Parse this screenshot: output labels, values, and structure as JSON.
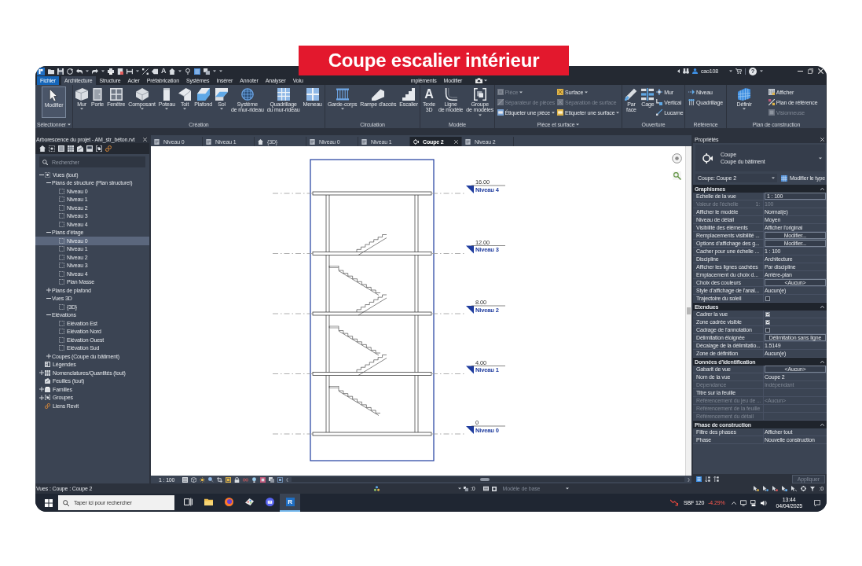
{
  "banner": {
    "text": "Coupe escalier intérieur"
  },
  "title_bar": {
    "glyph": "A",
    "user": "cao108",
    "help": "?"
  },
  "ribbon": {
    "tabs": [
      {
        "label": "Fichier",
        "kind": "file",
        "selected": false
      },
      {
        "label": "Architecture",
        "kind": "tab",
        "selected": true
      },
      {
        "label": "Structure",
        "kind": "tab",
        "selected": false
      },
      {
        "label": "Acier",
        "kind": "tab",
        "selected": false
      },
      {
        "label": "Préfabrication",
        "kind": "tab",
        "selected": false
      },
      {
        "label": "Systèmes",
        "kind": "tab",
        "selected": false
      },
      {
        "label": "Insérer",
        "kind": "tab",
        "selected": false
      },
      {
        "label": "Annoter",
        "kind": "tab",
        "selected": false
      },
      {
        "label": "Analyser",
        "kind": "tab",
        "selected": false
      },
      {
        "label": "Volu",
        "kind": "partial",
        "selected": false
      },
      {
        "label": "mpléments",
        "kind": "partial",
        "selected": false
      },
      {
        "label": "Modifier",
        "kind": "tab",
        "selected": false
      }
    ],
    "panels": [
      {
        "title": "Sélectionner",
        "dropdown": true,
        "tools": [
          {
            "label": "Modifier",
            "kind": "large",
            "selected": true,
            "dropdown": false,
            "disabled": false
          }
        ]
      },
      {
        "title": "Création",
        "dropdown": false,
        "tools": [
          {
            "label": "Mur",
            "kind": "large",
            "selected": false,
            "dropdown": true,
            "disabled": false
          },
          {
            "label": "Porte",
            "kind": "large",
            "selected": false,
            "dropdown": false,
            "disabled": false
          },
          {
            "label": "Fenêtre",
            "kind": "large",
            "selected": false,
            "dropdown": false,
            "disabled": false
          },
          {
            "label": "Composant",
            "kind": "large",
            "selected": false,
            "dropdown": true,
            "disabled": false
          },
          {
            "label": "Poteau",
            "kind": "large",
            "selected": false,
            "dropdown": true,
            "disabled": false
          },
          {
            "label": "Toit",
            "kind": "large",
            "selected": false,
            "dropdown": true,
            "disabled": false
          },
          {
            "label": "Plafond",
            "kind": "large",
            "selected": false,
            "dropdown": false,
            "disabled": false
          },
          {
            "label": "Sol",
            "kind": "large",
            "selected": false,
            "dropdown": true,
            "disabled": false
          },
          {
            "label": "Système\nde mur-rideau",
            "kind": "large",
            "selected": false,
            "dropdown": false,
            "disabled": false
          },
          {
            "label": "Quadrillage\ndu mur-rideau",
            "kind": "large",
            "selected": false,
            "dropdown": false,
            "disabled": false
          },
          {
            "label": "Meneau",
            "kind": "large",
            "selected": false,
            "dropdown": false,
            "disabled": false
          }
        ]
      },
      {
        "title": "Circulation",
        "dropdown": false,
        "tools": [
          {
            "label": "Garde-corps",
            "kind": "large",
            "selected": false,
            "dropdown": true,
            "disabled": false
          },
          {
            "label": "Rampe d'accès",
            "kind": "large",
            "selected": false,
            "dropdown": false,
            "disabled": false
          },
          {
            "label": "Escalier",
            "kind": "large",
            "selected": false,
            "dropdown": false,
            "disabled": false
          }
        ]
      },
      {
        "title": "Modèle",
        "dropdown": false,
        "tools": [
          {
            "label": "Texte\n3D",
            "glyph": "A",
            "kind": "large",
            "selected": false,
            "dropdown": false,
            "disabled": false
          },
          {
            "label": "Ligne\nde modèle",
            "kind": "large",
            "selected": false,
            "dropdown": false,
            "disabled": false
          },
          {
            "label": "Groupe\nde modèles",
            "kind": "large",
            "selected": false,
            "dropdown": true,
            "disabled": false
          }
        ]
      },
      {
        "title": "Pièce et surface",
        "dropdown": true,
        "tools": [
          {
            "label": "Pièce",
            "kind": "small",
            "selected": false,
            "dropdown": true,
            "disabled": true
          },
          {
            "label": "Séparateur de pièces",
            "kind": "small",
            "selected": false,
            "dropdown": false,
            "disabled": true
          },
          {
            "label": "Étiqueter une pièce",
            "kind": "small",
            "selected": false,
            "dropdown": true,
            "disabled": false
          },
          {
            "label": "Surface",
            "kind": "small",
            "selected": false,
            "dropdown": true,
            "disabled": false
          },
          {
            "label": "Séparation de surface",
            "kind": "small",
            "selected": false,
            "dropdown": false,
            "disabled": true
          },
          {
            "label": "Etiqueter une surface",
            "kind": "small",
            "selected": false,
            "dropdown": true,
            "disabled": false
          }
        ]
      },
      {
        "title": "Ouverture",
        "dropdown": false,
        "tools": [
          {
            "label": "Par\nface",
            "kind": "large",
            "selected": false,
            "dropdown": false,
            "disabled": false
          },
          {
            "label": "Cage",
            "kind": "large",
            "selected": false,
            "dropdown": false,
            "disabled": false
          },
          {
            "label": "Mur",
            "kind": "small",
            "selected": false,
            "dropdown": false,
            "disabled": false
          },
          {
            "label": "Vertical",
            "kind": "small",
            "selected": false,
            "dropdown": false,
            "disabled": false
          },
          {
            "label": "Lucarne",
            "kind": "small",
            "selected": false,
            "dropdown": false,
            "disabled": false
          }
        ]
      },
      {
        "title": "Référence",
        "dropdown": false,
        "tools": [
          {
            "label": "Niveau",
            "kind": "small",
            "selected": false,
            "dropdown": false,
            "disabled": false
          },
          {
            "label": "Quadrillage",
            "kind": "small",
            "selected": false,
            "dropdown": false,
            "disabled": false
          }
        ]
      },
      {
        "title": "Plan de construction",
        "dropdown": false,
        "tools": [
          {
            "label": "Définir",
            "kind": "large",
            "selected": false,
            "dropdown": true,
            "disabled": false
          },
          {
            "label": "Afficher",
            "kind": "small",
            "selected": false,
            "dropdown": false,
            "disabled": false
          },
          {
            "label": "Plan de référence",
            "kind": "small",
            "selected": false,
            "dropdown": false,
            "disabled": false
          },
          {
            "label": "Visionneuse",
            "kind": "small",
            "selected": false,
            "dropdown": false,
            "disabled": true
          }
        ]
      }
    ]
  },
  "project_browser": {
    "title": "Arborescence du projet - AM_str_béton.rvt",
    "search": {
      "placeholder": "Rechercher"
    },
    "tree": [
      {
        "label": "Vues (tout)",
        "kind": "views",
        "expanded": true,
        "selected": false,
        "children": [
          {
            "label": "Plans de structure (Plan structurel)",
            "kind": "category",
            "expanded": true,
            "selected": false,
            "children": [
              {
                "label": "Niveau 0",
                "kind": "view",
                "selected": false
              },
              {
                "label": "Niveau 1",
                "kind": "view",
                "selected": false
              },
              {
                "label": "Niveau 2",
                "kind": "view",
                "selected": false
              },
              {
                "label": "Niveau 3",
                "kind": "view",
                "selected": false
              },
              {
                "label": "Niveau 4",
                "kind": "view",
                "selected": false
              }
            ]
          },
          {
            "label": "Plans d'étage",
            "kind": "category",
            "expanded": true,
            "selected": false,
            "children": [
              {
                "label": "Niveau 0",
                "kind": "view",
                "selected": true
              },
              {
                "label": "Niveau 1",
                "kind": "view",
                "selected": false
              },
              {
                "label": "Niveau 2",
                "kind": "view",
                "selected": false
              },
              {
                "label": "Niveau 3",
                "kind": "view",
                "selected": false
              },
              {
                "label": "Niveau 4",
                "kind": "view",
                "selected": false
              },
              {
                "label": "Plan Masse",
                "kind": "view",
                "selected": false
              }
            ]
          },
          {
            "label": "Plans de plafond",
            "kind": "category",
            "expanded": false,
            "selected": false
          },
          {
            "label": "Vues 3D",
            "kind": "category",
            "expanded": true,
            "selected": false,
            "children": [
              {
                "label": "{3D}",
                "kind": "view",
                "selected": false
              }
            ]
          },
          {
            "label": "Elévations",
            "kind": "category",
            "expanded": true,
            "selected": false,
            "children": [
              {
                "label": "Elévation Est",
                "kind": "view",
                "selected": false
              },
              {
                "label": "Elévation Nord",
                "kind": "view",
                "selected": false
              },
              {
                "label": "Elévation Ouest",
                "kind": "view",
                "selected": false
              },
              {
                "label": "Elévation Sud",
                "kind": "view",
                "selected": false
              }
            ]
          },
          {
            "label": "Coupes (Coupe du bâtiment)",
            "kind": "category",
            "expanded": false,
            "selected": false
          }
        ]
      },
      {
        "label": "Légendes",
        "kind": "legends",
        "selected": false
      },
      {
        "label": "Nomenclatures/Quantités (tout)",
        "kind": "schedules",
        "expanded": false,
        "selected": false
      },
      {
        "label": "Feuilles (tout)",
        "kind": "sheets",
        "selected": false
      },
      {
        "label": "Familles",
        "kind": "families",
        "expanded": false,
        "selected": false
      },
      {
        "label": "Groupes",
        "kind": "groups",
        "expanded": false,
        "selected": false
      },
      {
        "label": "Liens Revit",
        "kind": "links",
        "selected": false
      }
    ]
  },
  "view": {
    "tabs": [
      {
        "label": "Niveau 0",
        "kind": "plan",
        "selected": false
      },
      {
        "label": "Niveau 1",
        "kind": "plan",
        "selected": false
      },
      {
        "label": "{3D}",
        "kind": "perspective",
        "selected": false
      },
      {
        "label": "Niveau 0",
        "kind": "plan",
        "selected": false
      },
      {
        "label": "Niveau 1",
        "kind": "plan",
        "selected": false
      },
      {
        "label": "Coupe 2",
        "kind": "section",
        "selected": true
      },
      {
        "label": "Niveau 2",
        "kind": "plan",
        "selected": false
      }
    ],
    "levels": [
      {
        "elevation": "16.00",
        "name": "Niveau 4"
      },
      {
        "elevation": "12.00",
        "name": "Niveau 3"
      },
      {
        "elevation": "8.00",
        "name": "Niveau 2"
      },
      {
        "elevation": "4.00",
        "name": "Niveau 1"
      },
      {
        "elevation": "0",
        "name": "Niveau 0"
      }
    ],
    "scale": "1 : 100"
  },
  "properties": {
    "title": "Propriétés",
    "type": {
      "name": "Coupe",
      "family": "Coupe du bâtiment"
    },
    "instance": "Coupe: Coupe 2",
    "edit_type": "Modifier le type",
    "groups": [
      {
        "title": "Graphismes",
        "expanded": true,
        "rows": [
          {
            "name": "Echelle de la vue",
            "kind": "field",
            "value": "1 : 100",
            "disabled": false
          },
          {
            "name": "Valeur de l'échelle",
            "unit": "1:",
            "kind": "text",
            "value": "100",
            "disabled": true
          },
          {
            "name": "Afficher le modèle",
            "kind": "text",
            "value": "Normal(e)",
            "disabled": false
          },
          {
            "name": "Niveau de détail",
            "kind": "text",
            "value": "Moyen",
            "disabled": false
          },
          {
            "name": "Visibilité des éléments",
            "kind": "text",
            "value": "Afficher l'original",
            "disabled": false
          },
          {
            "name": "Remplacements visibilité ...",
            "kind": "button",
            "value": "Modifier...",
            "disabled": false
          },
          {
            "name": "Options d'affichage des g...",
            "kind": "button",
            "value": "Modifier...",
            "disabled": false
          },
          {
            "name": "Cacher pour une échelle ...",
            "kind": "text",
            "value": "1 : 100",
            "disabled": false
          },
          {
            "name": "Discipline",
            "kind": "text",
            "value": "Architecture",
            "disabled": false
          },
          {
            "name": "Afficher les lignes cachées",
            "kind": "text",
            "value": "Par discipline",
            "disabled": false
          },
          {
            "name": "Emplacement du choix d...",
            "kind": "text",
            "value": "Arrière-plan",
            "disabled": false
          },
          {
            "name": "Choix des couleurs",
            "kind": "button",
            "value": "<Aucun>",
            "disabled": false
          },
          {
            "name": "Style d'affichage de l'anal...",
            "kind": "text",
            "value": "Aucun(e)",
            "disabled": false
          },
          {
            "name": "Trajectoire du soleil",
            "kind": "checkbox",
            "checked": false,
            "disabled": false
          }
        ]
      },
      {
        "title": "Etendues",
        "expanded": true,
        "rows": [
          {
            "name": "Cadrer la vue",
            "kind": "checkbox",
            "checked": true,
            "disabled": false
          },
          {
            "name": "Zone cadrée visible",
            "kind": "checkbox",
            "checked": true,
            "disabled": false
          },
          {
            "name": "Cadrage de l'annotation",
            "kind": "checkbox",
            "checked": false,
            "disabled": false
          },
          {
            "name": "Délimitation éloignée",
            "kind": "button",
            "value": "Délimitation sans ligne",
            "disabled": false
          },
          {
            "name": "Décalage de la délimitatio...",
            "kind": "text",
            "value": "1.5149",
            "disabled": false
          },
          {
            "name": "Zone de définition",
            "kind": "text",
            "value": "Aucun(e)",
            "disabled": false
          }
        ]
      },
      {
        "title": "Données d'identification",
        "expanded": true,
        "rows": [
          {
            "name": "Gabarit de vue",
            "kind": "button",
            "value": "<Aucun>",
            "disabled": false
          },
          {
            "name": "Nom de la vue",
            "kind": "text",
            "value": "Coupe 2",
            "disabled": false
          },
          {
            "name": "Dépendance",
            "kind": "text",
            "value": "Indépendant",
            "disabled": true
          },
          {
            "name": "Titre sur la feuille",
            "kind": "text",
            "disabled": false
          },
          {
            "name": "Référencement du jeu de ...",
            "kind": "text",
            "value": "<Aucun>",
            "disabled": true
          },
          {
            "name": "Référencement de la feuille",
            "kind": "text",
            "disabled": true
          },
          {
            "name": "Référencement du détail",
            "kind": "text",
            "disabled": true
          }
        ]
      },
      {
        "title": "Phase de construction",
        "expanded": true,
        "rows": [
          {
            "name": "Filtre des phases",
            "kind": "text",
            "value": "Afficher tout",
            "disabled": false
          },
          {
            "name": "Phase",
            "kind": "text",
            "value": "Nouvelle construction",
            "disabled": false
          }
        ]
      }
    ],
    "apply": {
      "label": "Appliquer",
      "disabled": true
    }
  },
  "status_bar": {
    "text": "Vues : Coupe : Coupe 2",
    "worksets": ":0",
    "model": "Modèle de base",
    "filter": ":0"
  },
  "taskbar": {
    "search": {
      "placeholder": "Taper ici pour rechercher"
    },
    "apps": [
      {
        "selected": false
      },
      {
        "selected": false
      },
      {
        "selected": false
      },
      {
        "selected": false
      },
      {
        "selected": false
      },
      {
        "selected": true,
        "glyph": "R"
      }
    ],
    "stock": {
      "name": "SBF 120",
      "change": "-4.29%"
    },
    "time": "13:44",
    "date": "04/04/2025"
  }
}
